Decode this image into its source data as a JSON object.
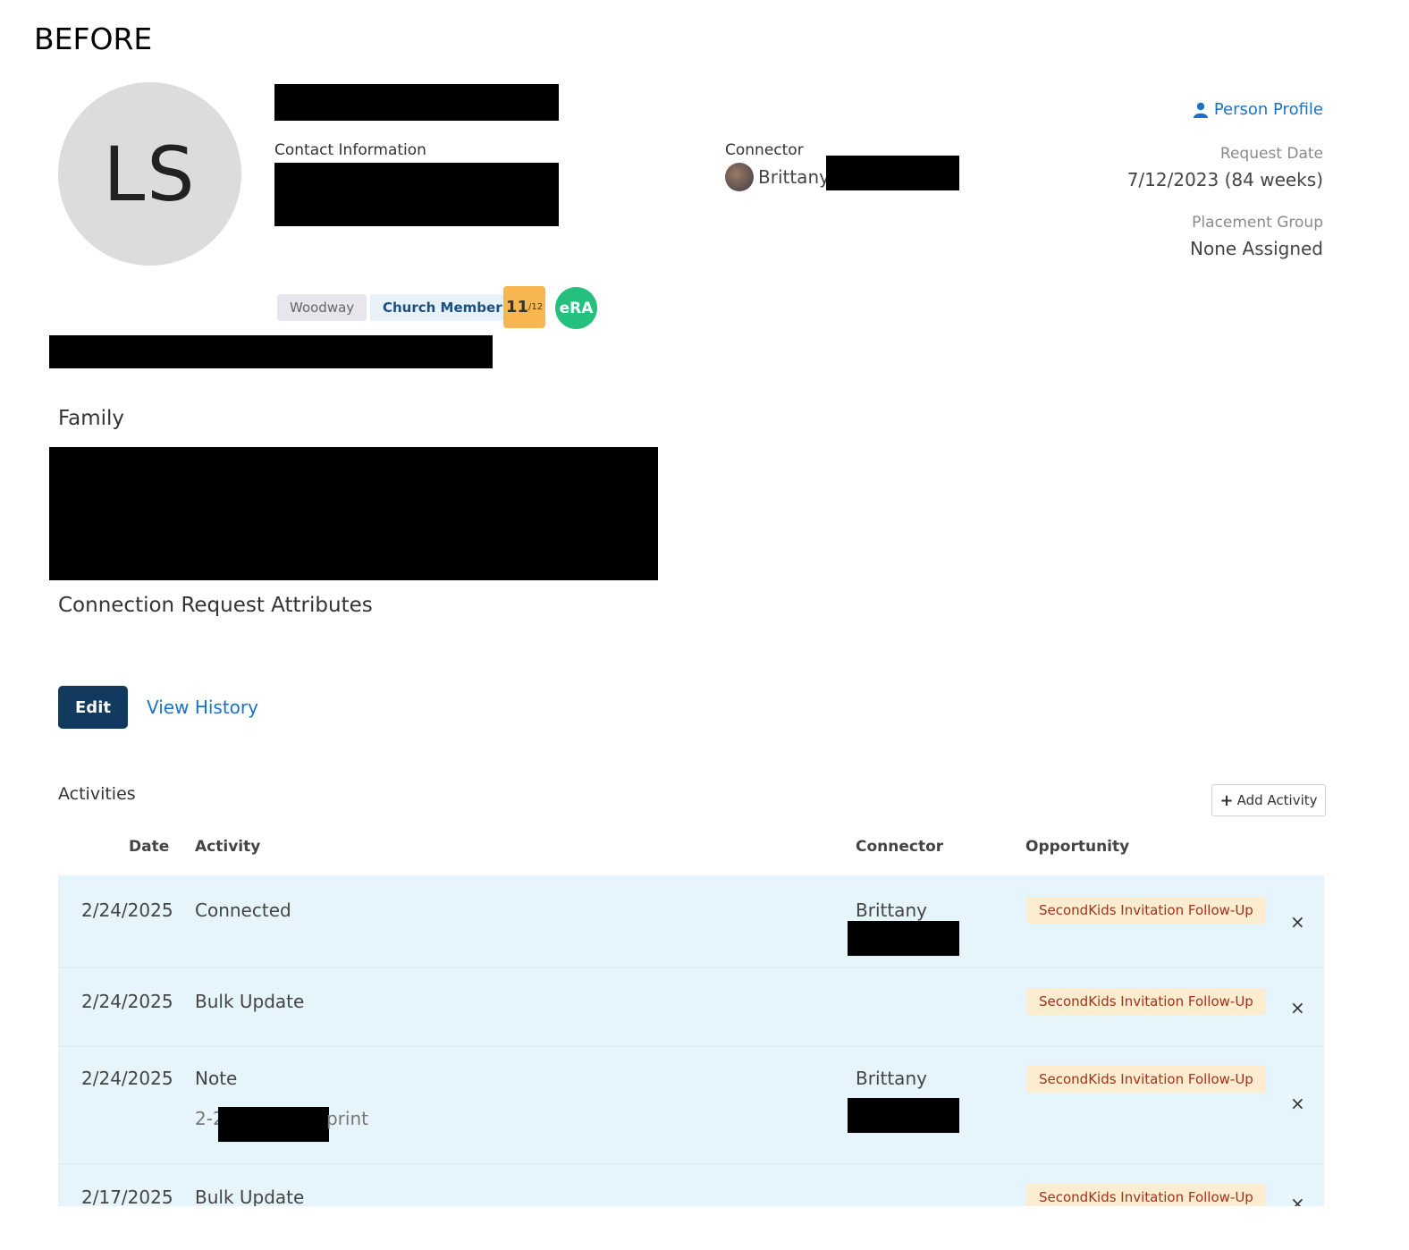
{
  "caption": "BEFORE",
  "avatar_initials": "LS",
  "contact": {
    "label": "Contact Information"
  },
  "connector": {
    "label": "Connector",
    "name": "Brittany"
  },
  "person_profile": {
    "label": "Person Profile",
    "icon": "user-icon"
  },
  "request_date": {
    "label": "Request Date",
    "value": "7/12/2023 (84 weeks)"
  },
  "placement_group": {
    "label": "Placement Group",
    "value": "None Assigned"
  },
  "badges": {
    "campus": "Woodway",
    "status": "Church Member",
    "date_num": "11",
    "date_sub": "/12",
    "era": "eRA"
  },
  "sections": {
    "family": "Family",
    "attributes": "Connection Request Attributes",
    "activities": "Activities"
  },
  "actions": {
    "edit": "Edit",
    "view_history": "View History",
    "add_activity": "Add Activity"
  },
  "table": {
    "headers": {
      "date": "Date",
      "activity": "Activity",
      "connector": "Connector",
      "opportunity": "Opportunity"
    },
    "rows": [
      {
        "date": "2/24/2025",
        "activity": "Connected",
        "connector": "Brittany",
        "opportunity": "SecondKids Invitation Follow-Up",
        "delete": "×"
      },
      {
        "date": "2/24/2025",
        "activity": "Bulk Update",
        "connector": "",
        "opportunity": "SecondKids Invitation Follow-Up",
        "delete": "×"
      },
      {
        "date": "2/24/2025",
        "activity": "Note",
        "note_prefix": "2-2",
        "note_suffix": "print",
        "connector": "Brittany",
        "opportunity": "SecondKids Invitation Follow-Up",
        "delete": "×"
      },
      {
        "date": "2/17/2025",
        "activity": "Bulk Update",
        "connector": "",
        "opportunity": "SecondKids Invitation Follow-Up",
        "delete": "×"
      }
    ]
  },
  "colors": {
    "link": "#1a73c9",
    "edit_button": "#123a5e",
    "table_bg": "#e6f5fb",
    "opportunity_badge_bg": "#fcecd0",
    "opportunity_badge_text": "#a0331d",
    "date_badge": "#f8b651",
    "era_badge": "#25c07e"
  }
}
